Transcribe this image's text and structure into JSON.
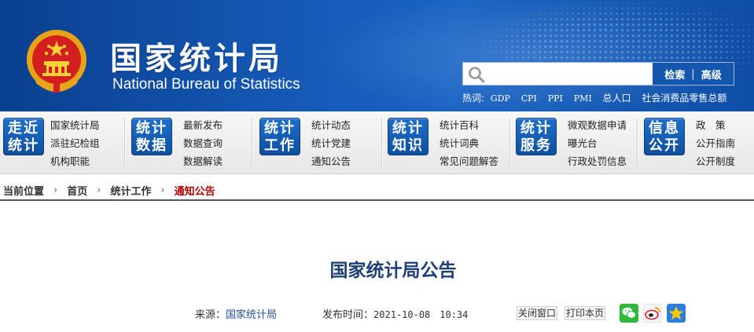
{
  "header": {
    "title_cn": "国家统计局",
    "title_en": "National Bureau of Statistics",
    "search": {
      "placeholder": "",
      "search_label": "检索",
      "separator": "|",
      "advanced_label": "高级"
    },
    "hot_words": {
      "label": "热词:",
      "items": [
        "GDP",
        "CPI",
        "PPI",
        "PMI",
        "总人口",
        "社会消费品零售总额"
      ]
    }
  },
  "nav": [
    {
      "badge": [
        "走近",
        "统计"
      ],
      "links": [
        "国家统计局",
        "派驻纪检组",
        "机构职能"
      ]
    },
    {
      "badge": [
        "统计",
        "数据"
      ],
      "links": [
        "最新发布",
        "数据查询",
        "数据解读"
      ]
    },
    {
      "badge": [
        "统计",
        "工作"
      ],
      "links": [
        "统计动态",
        "统计党建",
        "通知公告"
      ]
    },
    {
      "badge": [
        "统计",
        "知识"
      ],
      "links": [
        "统计百科",
        "统计词典",
        "常见问题解答"
      ]
    },
    {
      "badge": [
        "统计",
        "服务"
      ],
      "links": [
        "微观数据申请",
        "曝光台",
        "行政处罚信息"
      ]
    },
    {
      "badge": [
        "信息",
        "公开"
      ],
      "links": [
        "政　策",
        "公开指南",
        "公开制度"
      ]
    }
  ],
  "breadcrumb": {
    "label": "当前位置",
    "items": [
      "首页",
      "统计工作",
      "通知公告"
    ]
  },
  "article": {
    "title": "国家统计局公告",
    "source_label": "来源：",
    "source_value": "国家统计局",
    "date_label": "发布时间：",
    "date_value": "2021-10-08　10:34",
    "close_label": "关闭窗口",
    "print_label": "打印本页"
  },
  "colors": {
    "header_blue": "#1457b2",
    "badge_blue": "#1f6fcb",
    "breadcrumb_current": "#b20000",
    "title_blue": "#1e3f77"
  }
}
